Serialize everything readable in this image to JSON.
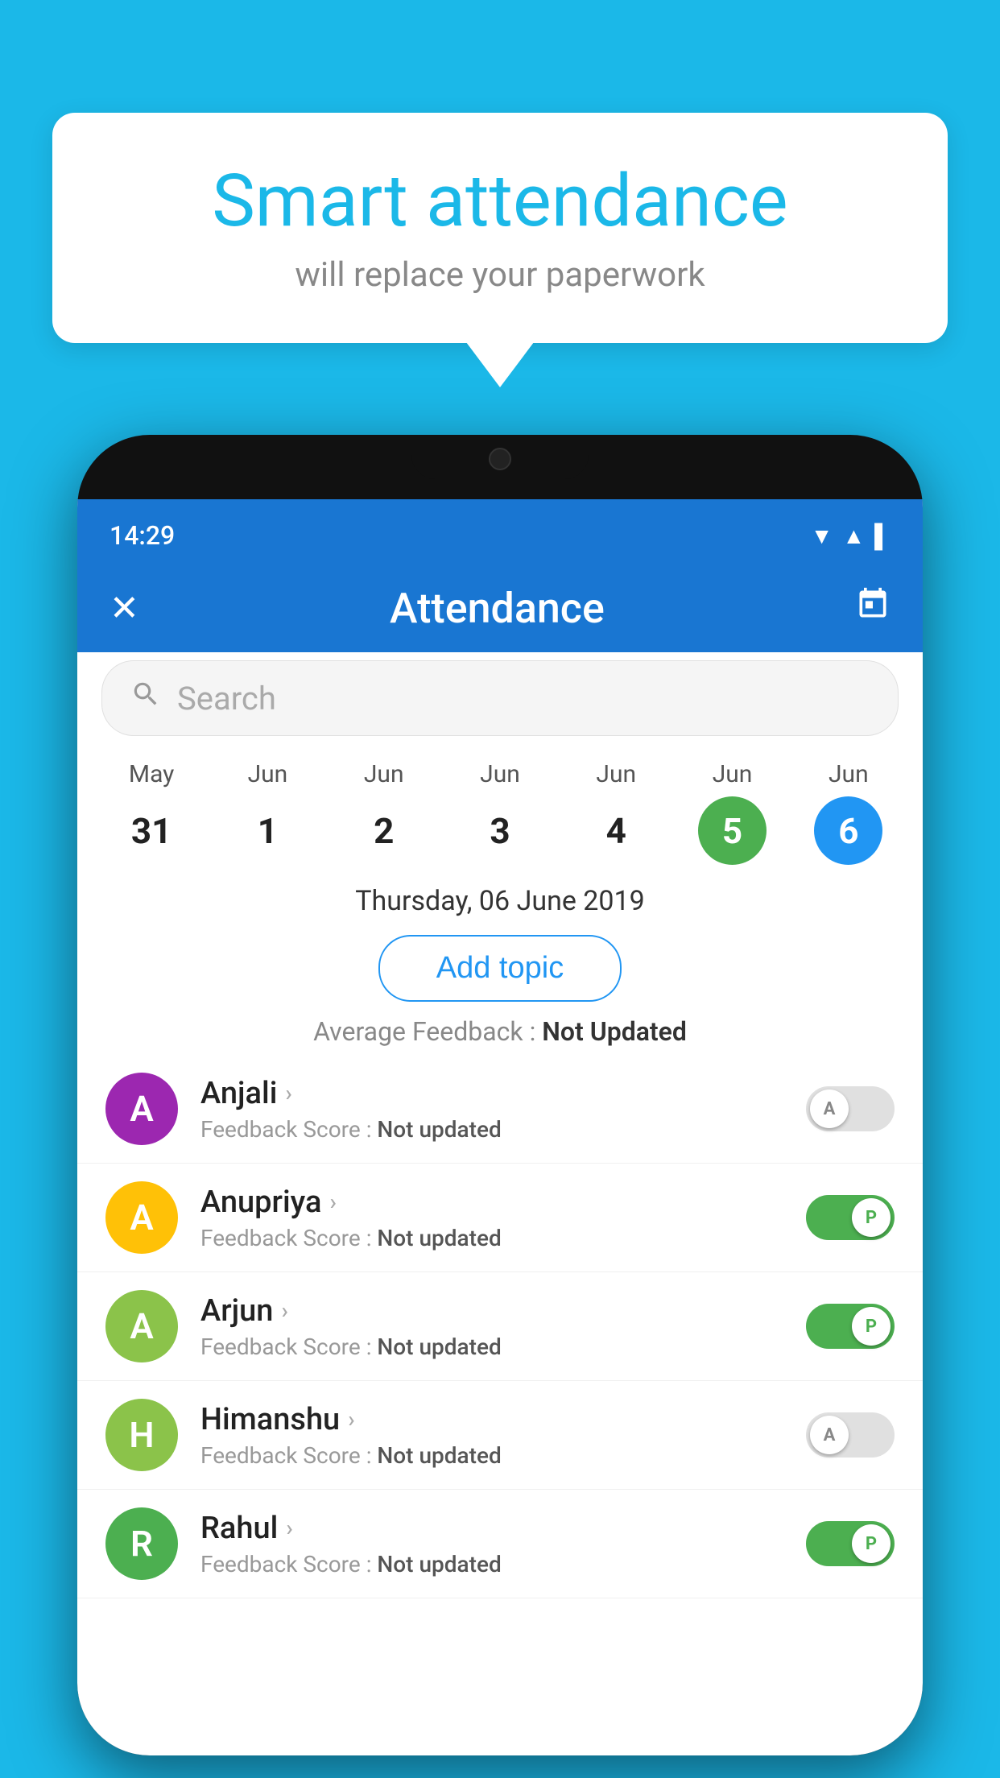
{
  "background_color": "#1BB8E8",
  "bubble": {
    "title": "Smart attendance",
    "subtitle": "will replace your paperwork"
  },
  "phone": {
    "status_bar": {
      "time": "14:29",
      "icons": "▼ ▲ ▌"
    },
    "app_bar": {
      "close_icon": "✕",
      "title": "Attendance",
      "calendar_icon": "📅"
    },
    "search": {
      "placeholder": "Search"
    },
    "calendar": {
      "days": [
        {
          "month": "May",
          "day": "31",
          "state": "normal"
        },
        {
          "month": "Jun",
          "day": "1",
          "state": "normal"
        },
        {
          "month": "Jun",
          "day": "2",
          "state": "normal"
        },
        {
          "month": "Jun",
          "day": "3",
          "state": "normal"
        },
        {
          "month": "Jun",
          "day": "4",
          "state": "normal"
        },
        {
          "month": "Jun",
          "day": "5",
          "state": "today"
        },
        {
          "month": "Jun",
          "day": "6",
          "state": "selected"
        }
      ]
    },
    "selected_date": "Thursday, 06 June 2019",
    "add_topic_label": "Add topic",
    "avg_feedback_label": "Average Feedback :",
    "avg_feedback_value": "Not Updated",
    "students": [
      {
        "name": "Anjali",
        "avatar_letter": "A",
        "avatar_color": "#9C27B0",
        "feedback_label": "Feedback Score :",
        "feedback_value": "Not updated",
        "toggle_state": "off",
        "toggle_letter": "A"
      },
      {
        "name": "Anupriya",
        "avatar_letter": "A",
        "avatar_color": "#FFC107",
        "feedback_label": "Feedback Score :",
        "feedback_value": "Not updated",
        "toggle_state": "on",
        "toggle_letter": "P"
      },
      {
        "name": "Arjun",
        "avatar_letter": "A",
        "avatar_color": "#8BC34A",
        "feedback_label": "Feedback Score :",
        "feedback_value": "Not updated",
        "toggle_state": "on",
        "toggle_letter": "P"
      },
      {
        "name": "Himanshu",
        "avatar_letter": "H",
        "avatar_color": "#8BC34A",
        "feedback_label": "Feedback Score :",
        "feedback_value": "Not updated",
        "toggle_state": "off",
        "toggle_letter": "A"
      },
      {
        "name": "Rahul",
        "avatar_letter": "R",
        "avatar_color": "#4CAF50",
        "feedback_label": "Feedback Score :",
        "feedback_value": "Not updated",
        "toggle_state": "on",
        "toggle_letter": "P"
      }
    ]
  }
}
